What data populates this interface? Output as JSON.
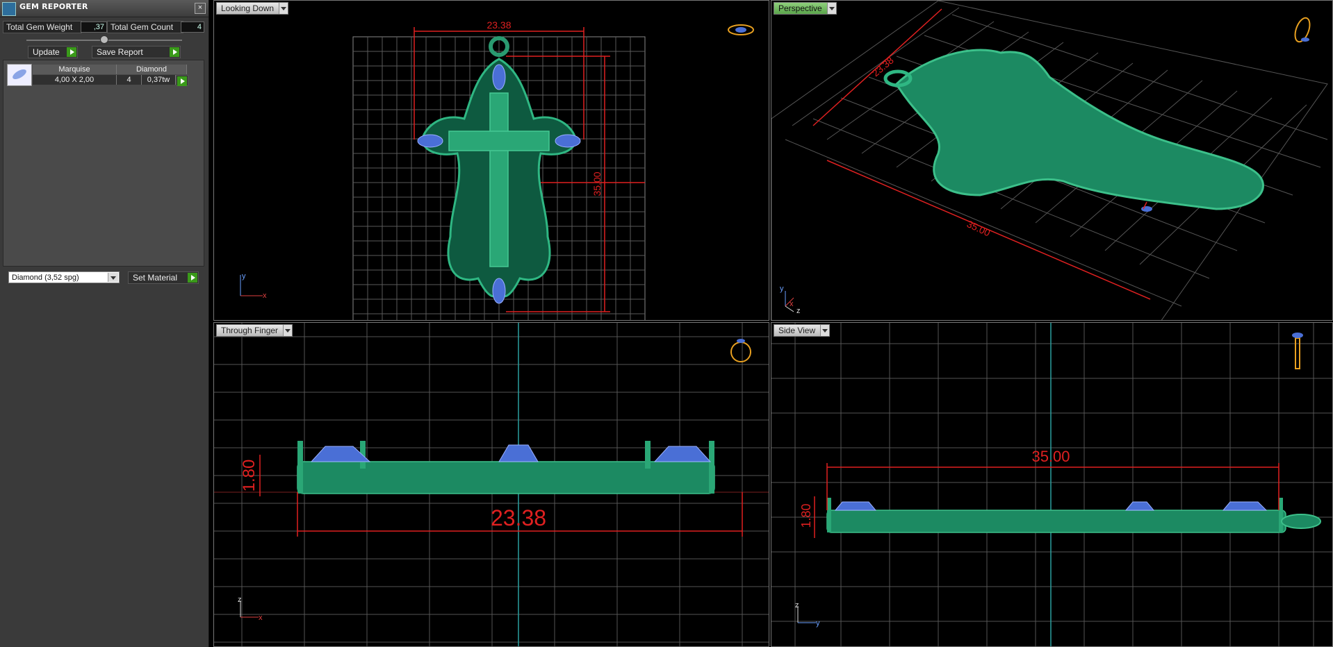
{
  "panel": {
    "title": "GEM REPORTER",
    "close_glyph": "×",
    "total_weight_label": "Total Gem Weight",
    "total_weight_value": ",37",
    "total_count_label": "Total Gem Count",
    "total_count_value": "4",
    "update_label": "Update",
    "save_label": "Save Report",
    "table": {
      "headers": [
        "Marquise",
        "Diamond"
      ],
      "rows": [
        {
          "size": "4,00 X 2,00",
          "count": "4",
          "weight": "0,37tw"
        }
      ]
    },
    "material": "Diamond     (3,52 spg)",
    "set_material_label": "Set Material"
  },
  "viewports": {
    "top_left": {
      "tab": "Looking Down",
      "dim_width": "23.38",
      "dim_height": "35.00",
      "axis_1": "y",
      "axis_2": "x"
    },
    "top_right": {
      "tab": "Perspective",
      "dim_width": "23.38",
      "dim_height": "35.00",
      "axis_1": "y",
      "axis_2": "x",
      "axis_3": "z"
    },
    "bottom_left": {
      "tab": "Through Finger",
      "dim_width": "23.38",
      "dim_height": "1.80",
      "axis_1": "z",
      "axis_2": "x"
    },
    "bottom_right": {
      "tab": "Side View",
      "dim_width": "35.00",
      "dim_height": "1.80",
      "axis_1": "z",
      "axis_2": "y"
    }
  },
  "icons": {
    "view_cube": "ring-orientation-icon",
    "gem": "marquise-gem-icon"
  },
  "colors": {
    "dimension": "#e02020",
    "model": "#1f8a63",
    "gem": "#4a6fd6",
    "grid": "#5a5a5a",
    "active_tab": "#6fb85c"
  }
}
